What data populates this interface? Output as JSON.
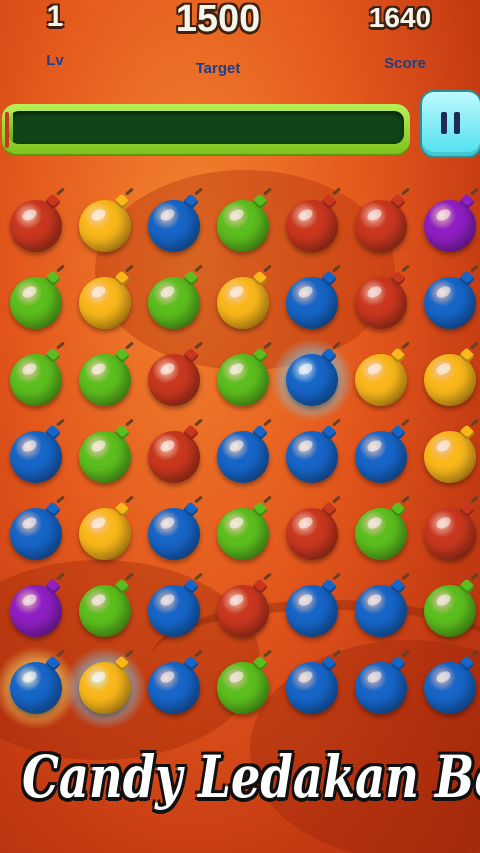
{
  "hud": {
    "level": {
      "value": "1",
      "label": "Lv"
    },
    "target": {
      "value": "1500",
      "label": "Target"
    },
    "score": {
      "value": "1640",
      "label": "Score"
    },
    "progress_fraction": 0.01
  },
  "pause_button": {
    "icon": "pause-icon"
  },
  "colors": {
    "red": "#c9371f",
    "yellow": "#f9b71b",
    "blue": "#1665c7",
    "green": "#5cbe1e",
    "purple": "#8f1fc2",
    "glow_blue": "#7ad9ff",
    "glow_yellow": "#fff27a"
  },
  "board": {
    "rows": [
      [
        "red",
        "yellow",
        "blue",
        "green",
        "red",
        "red",
        "purple"
      ],
      [
        "green",
        "yellow",
        "green",
        "yellow",
        "blue",
        "red",
        "blue"
      ],
      [
        "green",
        "green",
        "red",
        "green",
        "blue",
        "yellow",
        "yellow"
      ],
      [
        "blue",
        "green",
        "red",
        "blue",
        "blue",
        "blue",
        "yellow"
      ],
      [
        "blue",
        "yellow",
        "blue",
        "green",
        "red",
        "green",
        "red"
      ],
      [
        "purple",
        "green",
        "blue",
        "red",
        "blue",
        "blue",
        "green"
      ],
      [
        "blue",
        "yellow",
        "blue",
        "green",
        "blue",
        "blue",
        "blue"
      ]
    ],
    "highlighted": [
      {
        "row": 2,
        "col": 4,
        "glow": "glow_blue"
      },
      {
        "row": 6,
        "col": 0,
        "glow": "glow_yellow"
      },
      {
        "row": 6,
        "col": 1,
        "glow": "glow_blue"
      }
    ]
  },
  "title_banner": "Candy Ledakan Bomb"
}
